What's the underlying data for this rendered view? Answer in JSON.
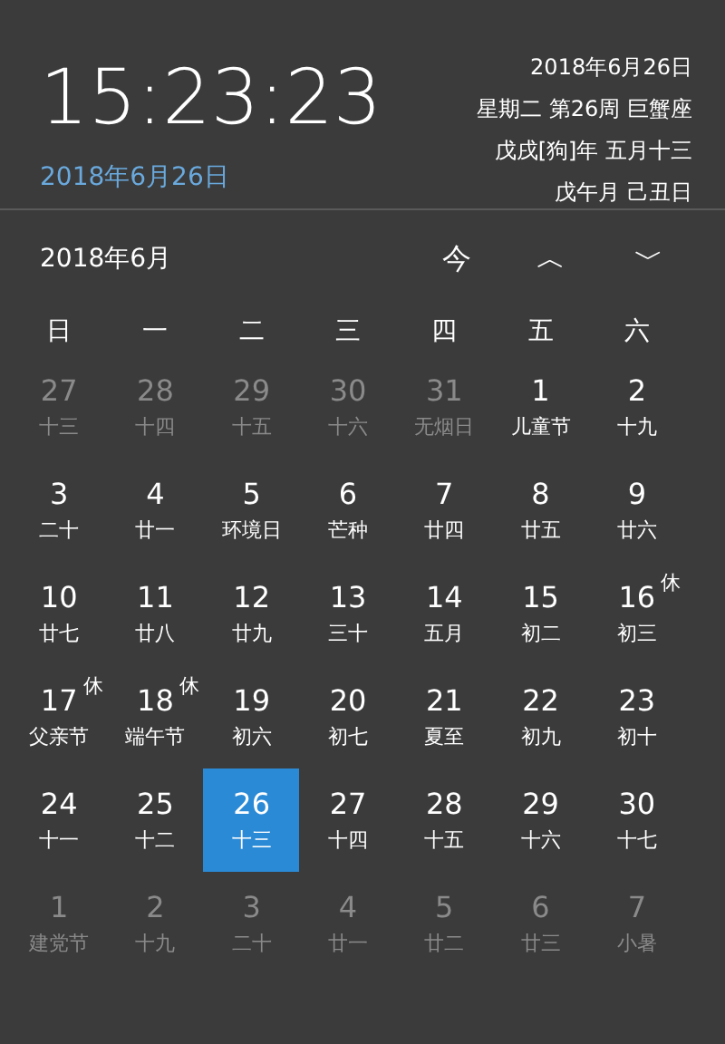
{
  "clock": {
    "time": "15:23:23",
    "date": "2018年6月26日"
  },
  "info": [
    "2018年6月26日",
    "星期二 第26周 巨蟹座",
    "戊戌[狗]年 五月十三",
    "戊午月 己丑日"
  ],
  "nav": {
    "month": "2018年6月",
    "today": "今",
    "prev": "︿",
    "next": "﹀"
  },
  "weekdays": [
    "日",
    "一",
    "二",
    "三",
    "四",
    "五",
    "六"
  ],
  "days": [
    {
      "day": "27",
      "lunar": "十三",
      "outside": true,
      "selected": false
    },
    {
      "day": "28",
      "lunar": "十四",
      "outside": true,
      "selected": false
    },
    {
      "day": "29",
      "lunar": "十五",
      "outside": true,
      "selected": false
    },
    {
      "day": "30",
      "lunar": "十六",
      "outside": true,
      "selected": false
    },
    {
      "day": "31",
      "lunar": "无烟日",
      "outside": true,
      "selected": false
    },
    {
      "day": "1",
      "lunar": "儿童节",
      "outside": false,
      "selected": false
    },
    {
      "day": "2",
      "lunar": "十九",
      "outside": false,
      "selected": false
    },
    {
      "day": "3",
      "lunar": "二十",
      "outside": false,
      "selected": false
    },
    {
      "day": "4",
      "lunar": "廿一",
      "outside": false,
      "selected": false
    },
    {
      "day": "5",
      "lunar": "环境日",
      "outside": false,
      "selected": false
    },
    {
      "day": "6",
      "lunar": "芒种",
      "outside": false,
      "selected": false
    },
    {
      "day": "7",
      "lunar": "廿四",
      "outside": false,
      "selected": false
    },
    {
      "day": "8",
      "lunar": "廿五",
      "outside": false,
      "selected": false
    },
    {
      "day": "9",
      "lunar": "廿六",
      "outside": false,
      "selected": false
    },
    {
      "day": "10",
      "lunar": "廿七",
      "outside": false,
      "selected": false
    },
    {
      "day": "11",
      "lunar": "廿八",
      "outside": false,
      "selected": false
    },
    {
      "day": "12",
      "lunar": "廿九",
      "outside": false,
      "selected": false
    },
    {
      "day": "13",
      "lunar": "三十",
      "outside": false,
      "selected": false
    },
    {
      "day": "14",
      "lunar": "五月",
      "outside": false,
      "selected": false
    },
    {
      "day": "15",
      "lunar": "初二",
      "outside": false,
      "selected": false
    },
    {
      "day": "16",
      "lunar": "初三",
      "outside": false,
      "selected": false,
      "badge": "休"
    },
    {
      "day": "17",
      "lunar": "父亲节",
      "outside": false,
      "selected": false,
      "badge": "休"
    },
    {
      "day": "18",
      "lunar": "端午节",
      "outside": false,
      "selected": false,
      "badge": "休"
    },
    {
      "day": "19",
      "lunar": "初六",
      "outside": false,
      "selected": false
    },
    {
      "day": "20",
      "lunar": "初七",
      "outside": false,
      "selected": false
    },
    {
      "day": "21",
      "lunar": "夏至",
      "outside": false,
      "selected": false
    },
    {
      "day": "22",
      "lunar": "初九",
      "outside": false,
      "selected": false
    },
    {
      "day": "23",
      "lunar": "初十",
      "outside": false,
      "selected": false
    },
    {
      "day": "24",
      "lunar": "十一",
      "outside": false,
      "selected": false
    },
    {
      "day": "25",
      "lunar": "十二",
      "outside": false,
      "selected": false
    },
    {
      "day": "26",
      "lunar": "十三",
      "outside": false,
      "selected": true
    },
    {
      "day": "27",
      "lunar": "十四",
      "outside": false,
      "selected": false
    },
    {
      "day": "28",
      "lunar": "十五",
      "outside": false,
      "selected": false
    },
    {
      "day": "29",
      "lunar": "十六",
      "outside": false,
      "selected": false
    },
    {
      "day": "30",
      "lunar": "十七",
      "outside": false,
      "selected": false
    },
    {
      "day": "1",
      "lunar": "建党节",
      "outside": true,
      "selected": false
    },
    {
      "day": "2",
      "lunar": "十九",
      "outside": true,
      "selected": false
    },
    {
      "day": "3",
      "lunar": "二十",
      "outside": true,
      "selected": false
    },
    {
      "day": "4",
      "lunar": "廿一",
      "outside": true,
      "selected": false
    },
    {
      "day": "5",
      "lunar": "廿二",
      "outside": true,
      "selected": false
    },
    {
      "day": "6",
      "lunar": "廿三",
      "outside": true,
      "selected": false
    },
    {
      "day": "7",
      "lunar": "小暑",
      "outside": true,
      "selected": false
    }
  ]
}
